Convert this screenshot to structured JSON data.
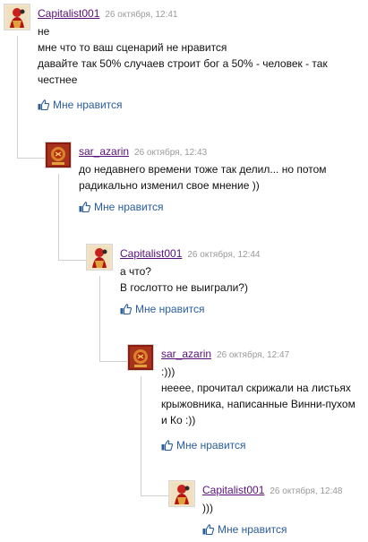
{
  "colors": {
    "author": "#5a0f7a",
    "date": "#9a9a9a",
    "like": "#2a5d9c",
    "connector": "#cfcfcf"
  },
  "comments": [
    {
      "author": "Capitalist001",
      "date": "26 октября, 12:41",
      "avatar_icon": "red-figure-avatar-icon",
      "lines": [
        "не",
        "мне что то ваш сценарий не нравится",
        "давайте так 50% случаев строит бог а 50% - человек - так",
        "честнее"
      ],
      "like_label": "Мне нравится"
    },
    {
      "author": "sar_azarin",
      "date": "26 октября, 12:43",
      "avatar_icon": "emblem-avatar-icon",
      "lines": [
        "до недавнего времени тоже так делил... но потом",
        "радикально изменил свое мнение ))"
      ],
      "like_label": "Мне нравится"
    },
    {
      "author": "Capitalist001",
      "date": "26 октября, 12:44",
      "avatar_icon": "red-figure-avatar-icon",
      "lines": [
        "а что?",
        "В гослотто не выиграли?)"
      ],
      "like_label": "Мне нравится"
    },
    {
      "author": "sar_azarin",
      "date": "26 октября, 12:47",
      "avatar_icon": "emblem-avatar-icon",
      "lines": [
        ":)))",
        "неееe, прочитал скрижали на листьях",
        "крыжовника, написанные Винни-пухом",
        "и Ко :))"
      ],
      "like_label": "Мне нравится"
    },
    {
      "author": "Capitalist001",
      "date": "26 октября, 12:48",
      "avatar_icon": "red-figure-avatar-icon",
      "lines": [
        ")))"
      ],
      "like_label": "Мне нравится"
    }
  ]
}
